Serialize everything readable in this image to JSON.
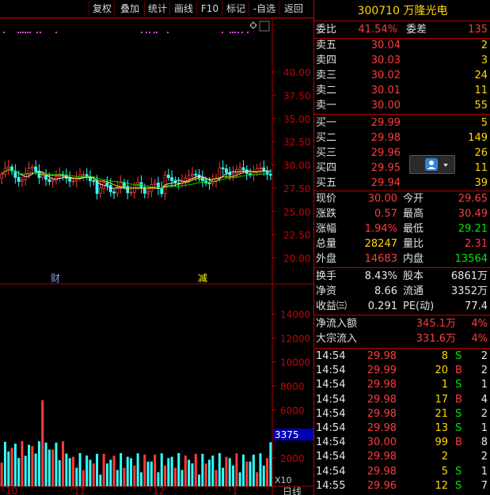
{
  "toolbar": {
    "items": [
      "复权",
      "叠加",
      "统计",
      "画线",
      "F10",
      "标记",
      "-自选",
      "返回"
    ]
  },
  "stock": {
    "code": "300710",
    "name": "万隆光电"
  },
  "price_axis": {
    "ticks": [
      "40.00",
      "37.50",
      "35.00",
      "32.50",
      "30.00",
      "27.50",
      "25.00",
      "22.50",
      "20.00"
    ]
  },
  "vol_axis": {
    "ticks": [
      "14000",
      "12000",
      "10000",
      "8000",
      "6000",
      "2000"
    ],
    "highlight": "3375",
    "multiplier": "X10"
  },
  "x_axis": {
    "labels": [
      "10",
      "11",
      "12",
      "1"
    ],
    "period": "日线"
  },
  "markers": {
    "cai": "财",
    "jian": "减"
  },
  "quote": {
    "weibi_label": "委比",
    "weibi": "41.54%",
    "weicha_label": "委差",
    "weicha": "135",
    "sell": [
      {
        "label": "卖五",
        "price": "30.04",
        "vol": "2"
      },
      {
        "label": "卖四",
        "price": "30.03",
        "vol": "3"
      },
      {
        "label": "卖三",
        "price": "30.02",
        "vol": "24"
      },
      {
        "label": "卖二",
        "price": "30.01",
        "vol": "11"
      },
      {
        "label": "卖一",
        "price": "30.00",
        "vol": "55"
      }
    ],
    "buy": [
      {
        "label": "买一",
        "price": "29.99",
        "vol": "5"
      },
      {
        "label": "买二",
        "price": "29.98",
        "vol": "149"
      },
      {
        "label": "买三",
        "price": "29.96",
        "vol": "26"
      },
      {
        "label": "买四",
        "price": "29.95",
        "vol": "11"
      },
      {
        "label": "买五",
        "price": "29.94",
        "vol": "39"
      }
    ],
    "stats": [
      {
        "l1": "现价",
        "v1": "30.00",
        "l2": "今开",
        "v2": "29.65"
      },
      {
        "l1": "涨跌",
        "v1": "0.57",
        "l2": "最高",
        "v2": "30.49"
      },
      {
        "l1": "涨幅",
        "v1": "1.94%",
        "l2": "最低",
        "v2": "29.21"
      },
      {
        "l1": "总量",
        "v1": "28247",
        "l2": "量比",
        "v2": "2.31"
      },
      {
        "l1": "外盘",
        "v1": "14683",
        "l2": "内盘",
        "v2": "13564"
      }
    ],
    "fund": [
      {
        "l1": "换手",
        "v1": "8.43%",
        "l2": "股本",
        "v2": "6861万"
      },
      {
        "l1": "净资",
        "v1": "8.66",
        "l2": "流通",
        "v2": "3352万"
      },
      {
        "l1": "收益㈢",
        "v1": "0.291",
        "l2": "PE(动)",
        "v2": "77.4"
      }
    ],
    "flow": [
      {
        "label": "净流入额",
        "value": "345.1万",
        "pct": "4%"
      },
      {
        "label": "大宗流入",
        "value": "331.6万",
        "pct": "4%"
      }
    ],
    "ticks": [
      {
        "time": "14:54",
        "price": "29.98",
        "vol": "8",
        "side": "S",
        "n": "2"
      },
      {
        "time": "14:54",
        "price": "29.99",
        "vol": "20",
        "side": "B",
        "n": "2"
      },
      {
        "time": "14:54",
        "price": "29.98",
        "vol": "1",
        "side": "S",
        "n": "1"
      },
      {
        "time": "14:54",
        "price": "29.98",
        "vol": "17",
        "side": "B",
        "n": "4"
      },
      {
        "time": "14:54",
        "price": "29.98",
        "vol": "21",
        "side": "S",
        "n": "2"
      },
      {
        "time": "14:54",
        "price": "29.98",
        "vol": "13",
        "side": "S",
        "n": "1"
      },
      {
        "time": "14:54",
        "price": "30.00",
        "vol": "99",
        "side": "B",
        "n": "8"
      },
      {
        "time": "14:54",
        "price": "29.98",
        "vol": "2",
        "side": "",
        "n": "2"
      },
      {
        "time": "14:54",
        "price": "29.98",
        "vol": "5",
        "side": "S",
        "n": "1"
      },
      {
        "time": "14:55",
        "price": "29.96",
        "vol": "12",
        "side": "S",
        "n": "7"
      }
    ]
  },
  "colors": {
    "up": "#ff3b3b",
    "down": "#3ff",
    "ma1": "#e8e8e8",
    "ma2": "#00d000",
    "grid": "#b00000",
    "accent": "#ffd800"
  }
}
